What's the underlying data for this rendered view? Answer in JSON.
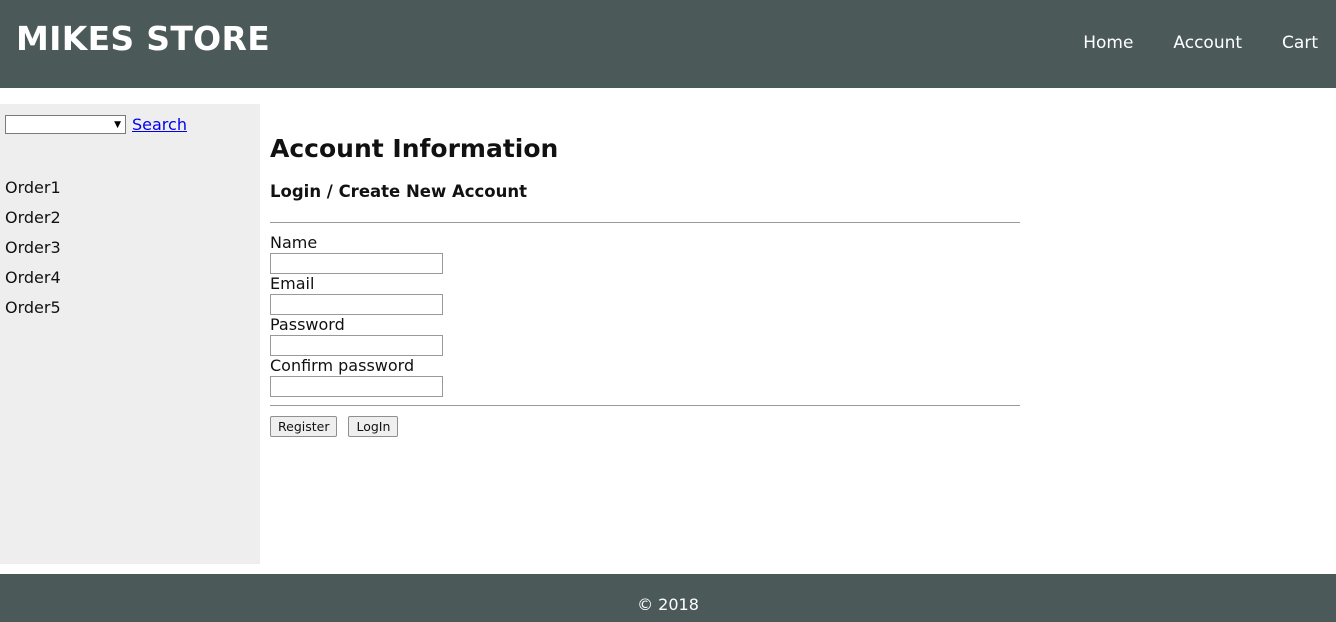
{
  "header": {
    "brand": "MIKES STORE",
    "nav": [
      "Home",
      "Account",
      "Cart"
    ]
  },
  "sidebar": {
    "search_select_value": "",
    "search_link": "Search",
    "orders": [
      "Order1",
      "Order2",
      "Order3",
      "Order4",
      "Order5"
    ]
  },
  "main": {
    "title": "Account Information",
    "subtitle": "Login / Create New Account",
    "fields": [
      {
        "label": "Name",
        "value": ""
      },
      {
        "label": "Email",
        "value": ""
      },
      {
        "label": "Password",
        "value": ""
      },
      {
        "label": "Confirm password",
        "value": ""
      }
    ],
    "buttons": {
      "register": "Register",
      "login": "LogIn"
    }
  },
  "footer": {
    "copyright": "© 2018"
  },
  "colors": {
    "header_bg": "#4b5959",
    "sidebar_bg": "#eeeeee",
    "link": "#0000ee"
  },
  "icons": {
    "select_arrow": "dropdown-arrow-icon"
  }
}
